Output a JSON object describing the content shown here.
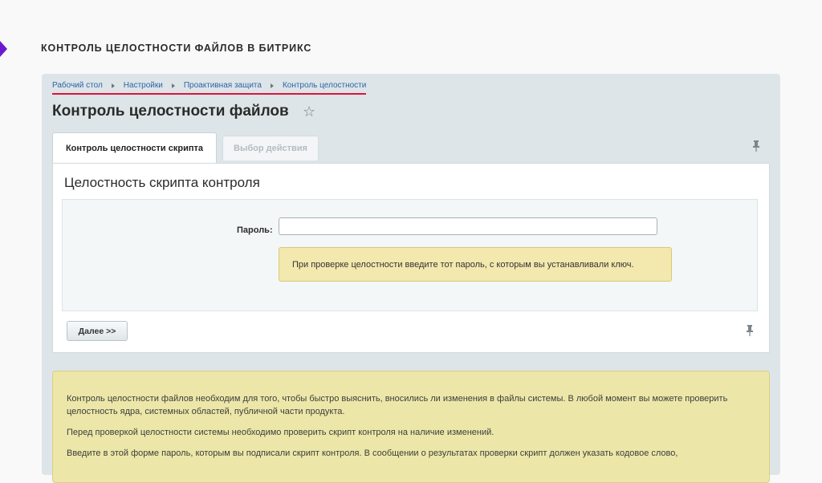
{
  "slide": {
    "title": "Контроль целостности файлов в Битрикс"
  },
  "breadcrumb": {
    "items": [
      "Рабочий стол",
      "Настройки",
      "Проактивная защита",
      "Контроль целостности"
    ]
  },
  "page": {
    "title": "Контроль целостности файлов"
  },
  "tabs": [
    {
      "label": "Контроль целостности скрипта",
      "active": true
    },
    {
      "label": "Выбор действия",
      "active": false
    }
  ],
  "panel": {
    "heading": "Целостность скрипта контроля",
    "password_label": "Пароль:",
    "password_value": "",
    "hint": "При проверке целостности введите тот пароль, с которым вы устанавливали ключ.",
    "next_label": "Далее >>"
  },
  "info": {
    "paragraphs": [
      "Контроль целостности файлов необходим для того, чтобы быстро выяснить, вносились ли изменения в файлы системы. В любой момент вы можете проверить целостность ядра, системных областей, публичной части продукта.",
      "Перед проверкой целостности системы необходимо проверить скрипт контроля на наличие изменений.",
      "Введите в этой форме пароль, которым вы подписали скрипт контроля. В сообщении о результатах проверки скрипт должен указать кодовое слово,"
    ]
  },
  "icons": {
    "favorite": "star-icon",
    "pin": "pin-icon"
  },
  "colors": {
    "accent_marker": "#6a1bd1",
    "breadcrumb_underline": "#e0123c",
    "link": "#2f63a6",
    "hint_bg": "#f3e8ad",
    "info_bg": "#ece7a8"
  }
}
